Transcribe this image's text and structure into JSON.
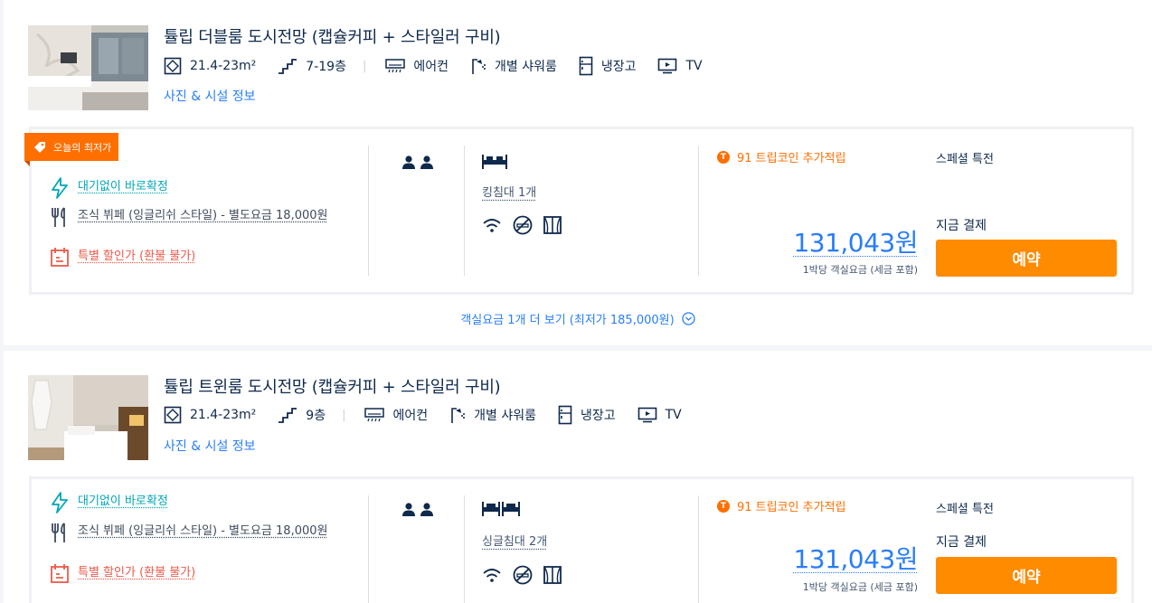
{
  "rooms": [
    {
      "title": "튤립 더블룸 도시전망 (캡슐커피 + 스타일러 구비)",
      "size": "21.4-23m²",
      "floor": "7-19층",
      "amenities": [
        "에어컨",
        "개별 샤워룸",
        "냉장고",
        "TV"
      ],
      "photo_link": "사진 & 시설 정보",
      "badge": "오늘의 최저가",
      "conditions": {
        "instant": "대기없이 바로확정",
        "breakfast": "조식 뷔페 (잉글리쉬 스타일) - 별도요금 18,000원",
        "refund": "특별 할인가 (환불 불가)"
      },
      "bed": "킹침대 1개",
      "coins": "91 트립코인 추가적립",
      "special": "스페셜 특전",
      "pay_now": "지금 결제",
      "price": "131,043원",
      "price_note": "1박당 객실요금 (세금 포함)",
      "book_label": "예약",
      "more_rates": "객실요금 1개 더 보기 (최저가 185,000원)"
    },
    {
      "title": "튤립 트윈룸 도시전망 (캡슐커피 + 스타일러 구비)",
      "size": "21.4-23m²",
      "floor": "9층",
      "amenities": [
        "에어컨",
        "개별 샤워룸",
        "냉장고",
        "TV"
      ],
      "photo_link": "사진 & 시설 정보",
      "conditions": {
        "instant": "대기없이 바로확정",
        "breakfast": "조식 뷔페 (잉글리쉬 스타일) - 별도요금 18,000원",
        "refund": "특별 할인가 (환불 불가)"
      },
      "bed": "싱글침대 2개",
      "coins": "91 트립코인 추가적립",
      "special": "스페셜 특전",
      "pay_now": "지금 결제",
      "price": "131,043원",
      "price_note": "1박당 객실요금 (세금 포함)",
      "book_label": "예약"
    }
  ],
  "colors": {
    "link": "#287dfa",
    "book_button": "#ff8b00",
    "badge": "#ff6f00",
    "teal": "#00a7b8",
    "red": "#eb5a4b"
  }
}
